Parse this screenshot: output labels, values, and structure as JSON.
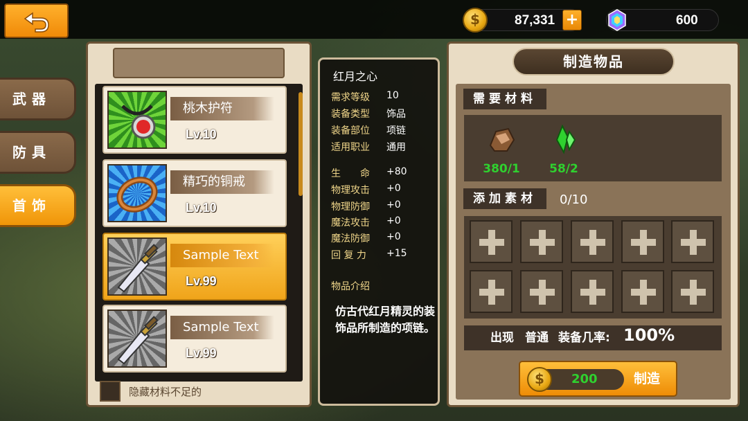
{
  "currency": {
    "gold": "87,331",
    "gems": "600"
  },
  "tabs": [
    {
      "label": "武器"
    },
    {
      "label": "防具"
    },
    {
      "label": "首饰"
    }
  ],
  "items": [
    {
      "name": "桃木护符",
      "level": "Lv.10",
      "icon": "amulet-icon"
    },
    {
      "name": "精巧的铜戒",
      "level": "Lv.10",
      "icon": "ring-icon"
    },
    {
      "name": "Sample Text",
      "level": "Lv.99",
      "icon": "sword-icon",
      "selected": true
    },
    {
      "name": "Sample Text",
      "level": "Lv.99",
      "icon": "sword-icon"
    }
  ],
  "hide_label": "隐藏材料不足的",
  "info": {
    "title": "红月之心",
    "stats": [
      {
        "k": "需求等级",
        "v": "10"
      },
      {
        "k": "装备类型",
        "v": "饰品"
      },
      {
        "k": "装备部位",
        "v": "项链"
      },
      {
        "k": "适用职业",
        "v": "通用"
      },
      {
        "k": "生　　命",
        "v": "+80"
      },
      {
        "k": "物理攻击",
        "v": "+0"
      },
      {
        "k": "物理防御",
        "v": "+0"
      },
      {
        "k": "魔法攻击",
        "v": "+0"
      },
      {
        "k": "魔法防御",
        "v": "+0"
      },
      {
        "k": "回 复 力",
        "v": "+15"
      }
    ],
    "desc_label": "物品介绍",
    "desc": "仿古代红月精灵的装饰品所制造的项链。"
  },
  "craft": {
    "title": "制造物品",
    "materials_label": "需要材料",
    "materials": [
      {
        "icon": "ore-icon",
        "count": "380/1"
      },
      {
        "icon": "crystal-icon",
        "count": "58/2"
      }
    ],
    "add_label": "添加素材",
    "add_count": "0/10",
    "appear_label": "出现",
    "appear_value": "普通",
    "rate_label": "装备几率:",
    "rate_value": "100%",
    "cost": "200",
    "button_label": "制造"
  }
}
